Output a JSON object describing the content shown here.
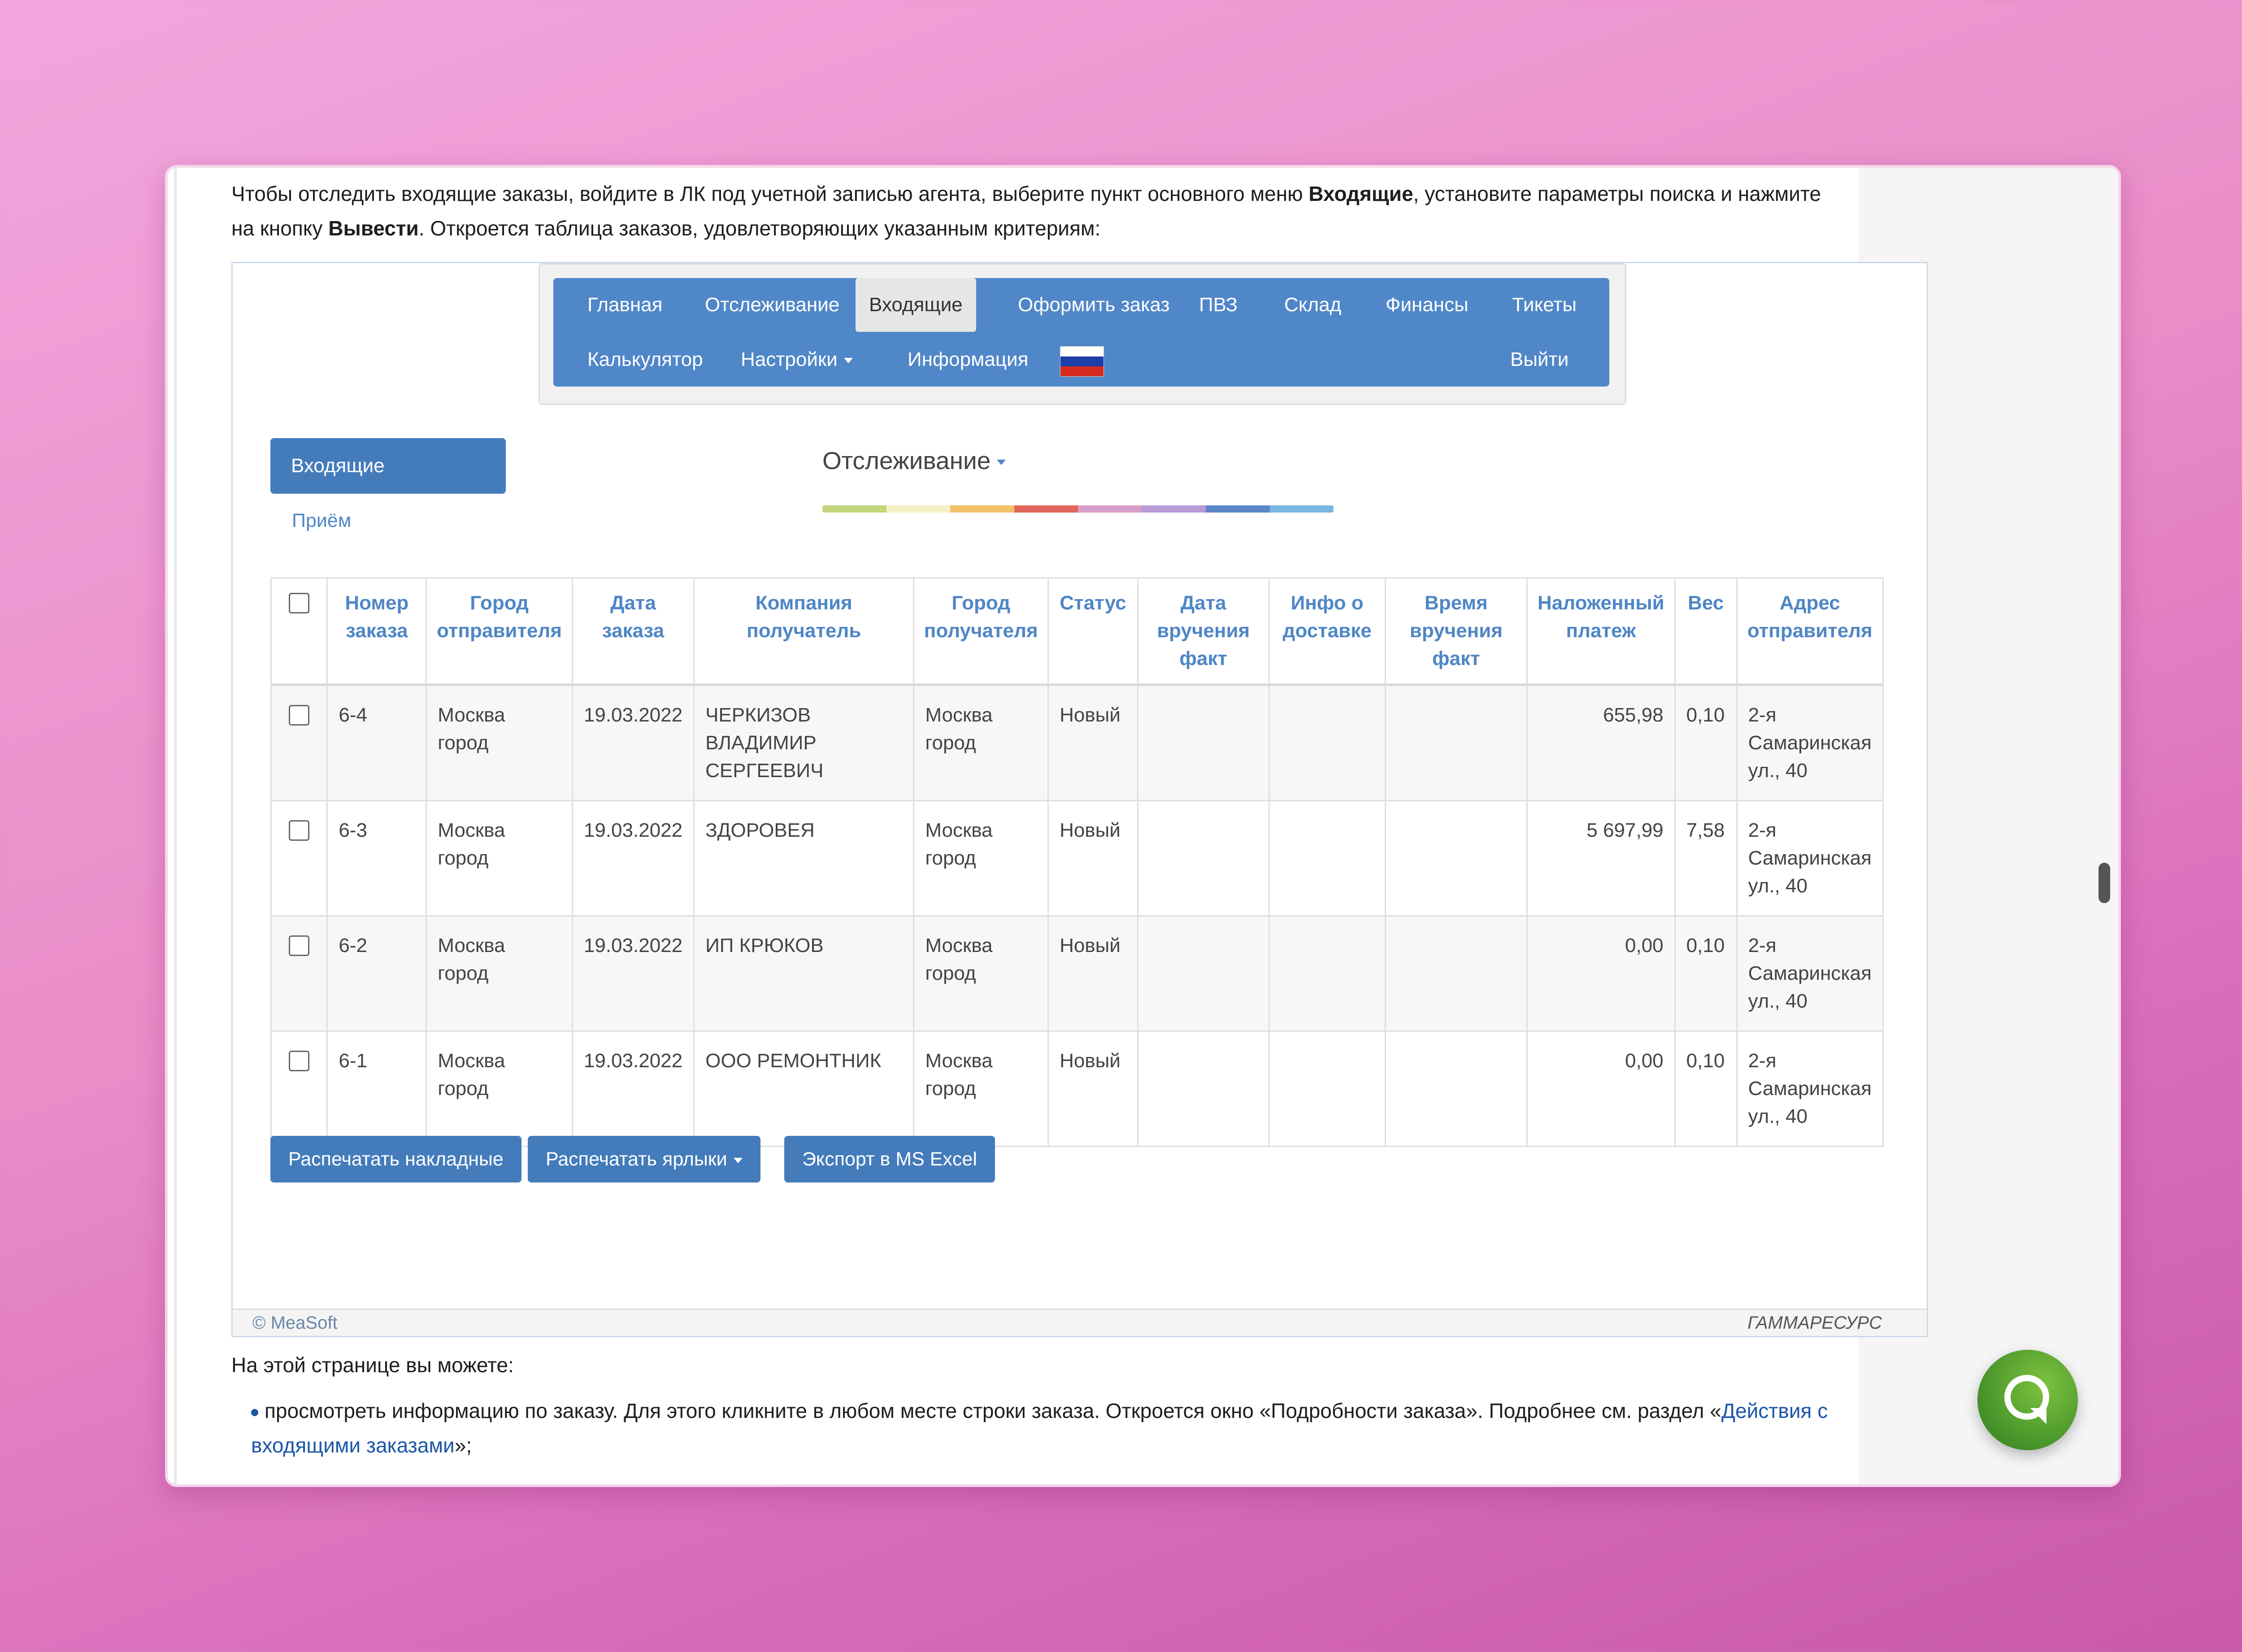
{
  "intro": {
    "p1_a": "Чтобы отследить входящие заказы, войдите в ЛК под учетной записью агента, выберите пункт основного меню ",
    "p1_b": "Входящие",
    "p1_c": ", установите параметры поиска и нажмите на кнопку ",
    "p1_d": "Вывести",
    "p1_e": ". Откроется таблица заказов, удовлетворяющих указанным критериям:"
  },
  "menu": {
    "row1": [
      "Главная",
      "Отслеживание",
      "Входящие",
      "Оформить заказ",
      "ПВЗ",
      "Склад",
      "Финансы",
      "Тикеты"
    ],
    "active": "Входящие",
    "calc": "Калькулятор",
    "settings": "Настройки",
    "info": "Информация",
    "logout": "Выйти",
    "flag_colors": [
      "#ffffff",
      "#1c3fa8",
      "#d52b1e"
    ]
  },
  "sidebar": {
    "incoming_button": "Входящие",
    "reception_link": "Приём"
  },
  "tracking": {
    "title": "Отслеживание",
    "rainbow": [
      "#c3d57a",
      "#f3f0c5",
      "#f1c16a",
      "#e0655a",
      "#d99ec8",
      "#b89ad8",
      "#5b86c9",
      "#7ab7e2"
    ]
  },
  "table": {
    "headers": [
      "Номер заказа",
      "Город отправителя",
      "Дата заказа",
      "Компания получатель",
      "Город получателя",
      "Статус",
      "Дата вручения факт",
      "Инфо о доставке",
      "Время вручения факт",
      "Наложенный платеж",
      "Вес",
      "Адрес отправителя"
    ],
    "rows": [
      {
        "num": "6-4",
        "from_city": "Москва город",
        "date": "19.03.2022",
        "company": "ЧЕРКИЗОВ ВЛАДИМИР СЕРГЕЕВИЧ",
        "to_city": "Москва город",
        "status": "Новый",
        "delivered_date": "",
        "delivery_info": "",
        "delivered_time": "",
        "cod": "655,98",
        "weight": "0,10",
        "address": "2-я Самаринская ул., 40"
      },
      {
        "num": "6-3",
        "from_city": "Москва город",
        "date": "19.03.2022",
        "company": "ЗДОРОВЕЯ",
        "to_city": "Москва город",
        "status": "Новый",
        "delivered_date": "",
        "delivery_info": "",
        "delivered_time": "",
        "cod": "5 697,99",
        "weight": "7,58",
        "address": "2-я Самаринская ул., 40"
      },
      {
        "num": "6-2",
        "from_city": "Москва город",
        "date": "19.03.2022",
        "company": "ИП КРЮКОВ",
        "to_city": "Москва город",
        "status": "Новый",
        "delivered_date": "",
        "delivery_info": "",
        "delivered_time": "",
        "cod": "0,00",
        "weight": "0,10",
        "address": "2-я Самаринская ул., 40"
      },
      {
        "num": "6-1",
        "from_city": "Москва город",
        "date": "19.03.2022",
        "company": "ООО РЕМОНТНИК",
        "to_city": "Москва город",
        "status": "Новый",
        "delivered_date": "",
        "delivery_info": "",
        "delivered_time": "",
        "cod": "0,00",
        "weight": "0,10",
        "address": "2-я Самаринская ул., 40"
      }
    ]
  },
  "actions": {
    "print_invoices": "Распечатать накладные",
    "print_labels": "Распечатать ярлыки",
    "export_excel": "Экспорт в MS Excel"
  },
  "footer": {
    "copyright": "© MeaSoft",
    "brand": "ГАММАРЕСУРС"
  },
  "after": {
    "intro": "На этой странице вы можете:",
    "bullet1_a": "просмотреть информацию по заказу. Для этого кликните в любом месте строки заказа. Откроется окно «Подробности заказа». Подробнее см. раздел «",
    "bullet1_link": "Действия с входящими заказами",
    "bullet1_b": "»;"
  },
  "colors": {
    "accent": "#447cbb",
    "menu_bg": "#5087c8",
    "header_text": "#4f86c6",
    "chat_green": "#4ea82f"
  }
}
